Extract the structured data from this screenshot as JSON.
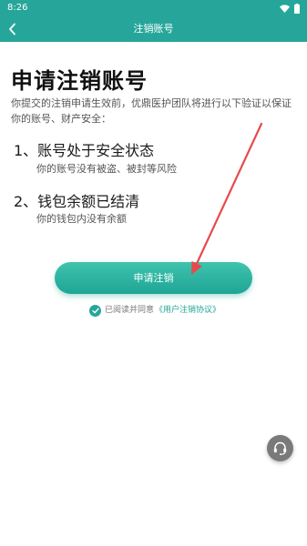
{
  "status_bar": {
    "time": "8:26"
  },
  "app_bar": {
    "title": "注销账号",
    "back_icon": "back-arrow-icon"
  },
  "heading": "申请注销账号",
  "intro": "你提交的注销申请生效前，优鼎医护团队将进行以下验证以保证你的账号、财产安全：",
  "requirements": [
    {
      "title": "1、账号处于安全状态",
      "desc": "你的账号没有被盗、被封等风险"
    },
    {
      "title": "2、钱包余额已结清",
      "desc": "你的钱包内没有余额"
    }
  ],
  "apply_button": {
    "label": "申请注销"
  },
  "agreement": {
    "checked": true,
    "text": "已阅读并同意",
    "link": "《用户注销协议》"
  },
  "colors": {
    "primary": "#26a69a",
    "button": "#2db3a2",
    "annotation": "#e84a4a"
  },
  "support_icon": "headset-icon"
}
